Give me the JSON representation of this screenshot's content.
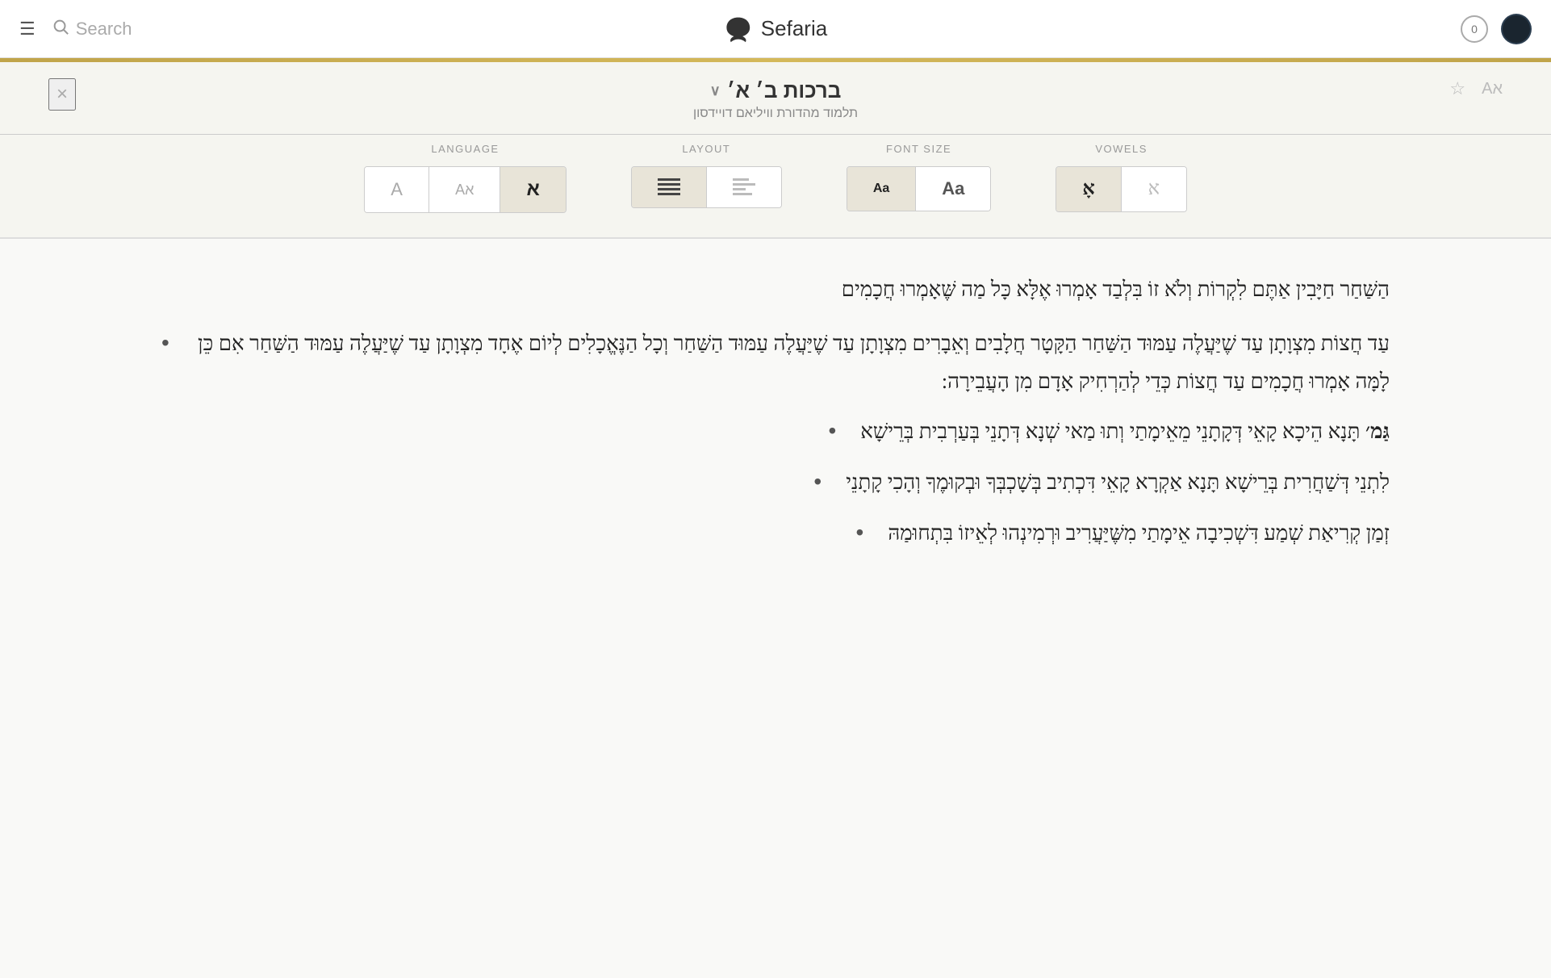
{
  "app": {
    "name": "Sefaria"
  },
  "nav": {
    "search_placeholder": "Search",
    "notification_count": "0"
  },
  "panel": {
    "title": "ברכות ב׳ א׳",
    "title_chevron": "∨",
    "subtitle": "תלמוד מהדורת וויליאם דויידסון",
    "close_label": "×",
    "star_label": "☆",
    "font_toggle_label": "Aא"
  },
  "language_control": {
    "label": "LANGUAGE",
    "options": [
      {
        "id": "english",
        "symbol": "A",
        "active": false
      },
      {
        "id": "bilingual",
        "symbol": "Aא",
        "active": false
      },
      {
        "id": "hebrew",
        "symbol": "א",
        "active": true
      }
    ]
  },
  "layout_control": {
    "label": "LAYOUT",
    "options": [
      {
        "id": "justified",
        "symbol": "≡",
        "active": true
      },
      {
        "id": "left-align",
        "symbol": "☰",
        "active": false
      }
    ]
  },
  "font_size_control": {
    "label": "FONT SIZE",
    "options": [
      {
        "id": "small",
        "symbol": "Aa",
        "active": true,
        "size": "small"
      },
      {
        "id": "large",
        "symbol": "Aa",
        "active": false,
        "size": "large"
      }
    ]
  },
  "vowels_control": {
    "label": "VOWELS",
    "options": [
      {
        "id": "with-vowels",
        "symbol": "אָ",
        "active": true
      },
      {
        "id": "without-vowels",
        "symbol": "א",
        "active": false
      }
    ]
  },
  "content": {
    "intro_text": "הַשַּׁחַר חַיָּבִין אַתֶּם לִקְרוֹת וְלֹא זוֹ בִּלְבַד אָמְרוּ אֶלָּא כָּל מַה שֶּׁאָמְרוּ חֲכָמִים",
    "bullets": [
      {
        "text": "עַד חֲצוֹת מִצְוָתָן עַד שֶׁיַּעֲלֶה עַמּוּד הַשַּׁחַר הַקָּטָר חֲלָבִים וְאֵבָרִים מִצְוָתָן עַד שֶׁיַּעֲלֶה עַמּוּד הַשַּׁחַר וְכָל הַנֶּאֱכָלִים לְיוֹם אֶחָד מִצְוָתָן עַד שֶׁיַּעֲלֶה עַמּוּד הַשַּׁחַר אִם כֵּן לָמָּה אָמְרוּ חֲכָמִים עַד חֲצוֹת כְּדֵי לְהַרְחִיק אָדָם מִן הָעֲבֵירָה:"
      },
      {
        "text": "גַּמ׳ תָּנָא הֵיכָא קָאֵי דְּקָתָנֵי מֵאֵימָתַי וְתוּ מַאי שְׁנָא דְּתָנֵי בְּעַרְבִית בְּרֵישָׁא",
        "bold_prefix": "גַּמ׳"
      },
      {
        "text": "לִתְנֵי דְּשַׁחֲרִית בְּרֵישָׁא תָּנָא אַקְרָא קָאֵי דִּכְתִיב בְּשָׁכְבְּךָ וּבְקוּמֶךָ וְהָכִי קָתָנֵי"
      },
      {
        "text": "זְמַן קְרִיאַת שְׁמַע דִּשְׁכִיבָה אֵימָתַי מִשֶּׁיַּעֲרִיב וּרְמִינְהוּ לְאֵיזוֹ בִּתְחוּמַהּ"
      }
    ]
  }
}
